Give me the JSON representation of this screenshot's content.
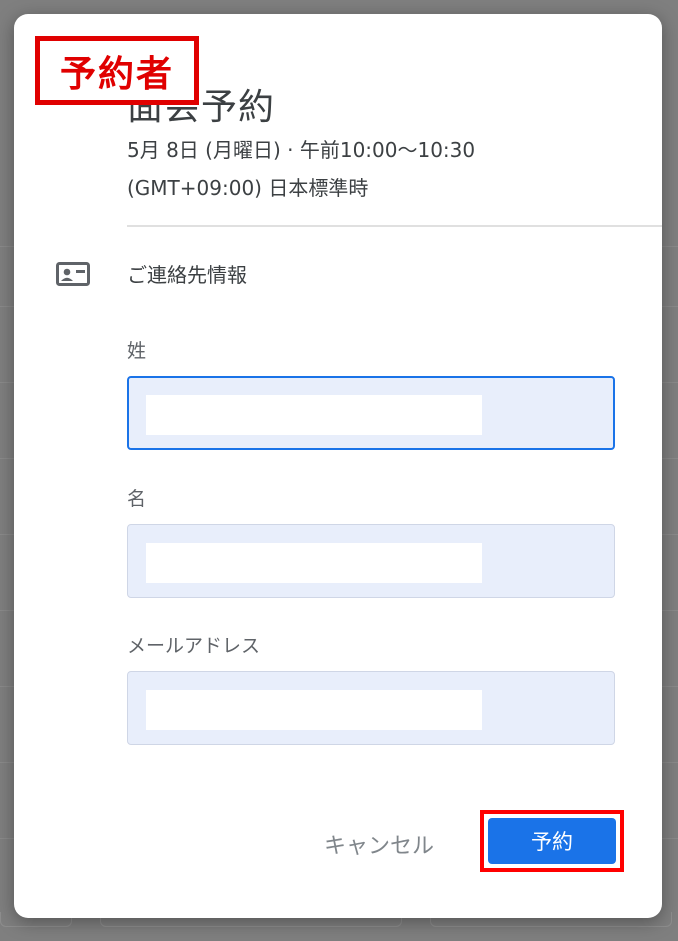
{
  "dialog": {
    "title": "面会予約",
    "datetime": "5月 8日 (月曜日) · 午前10:00～10:30",
    "timezone": "(GMT+09:00) 日本標準時",
    "section_title": "ご連絡先情報",
    "section_icon": "contact-card-icon"
  },
  "form": {
    "last_name_label": "姓",
    "last_name_value": "",
    "first_name_label": "名",
    "first_name_value": "",
    "email_label": "メールアドレス",
    "email_value": ""
  },
  "actions": {
    "cancel_label": "キャンセル",
    "reserve_label": "予約"
  },
  "annotation": {
    "label": "予約者",
    "color": "#e00000"
  },
  "colors": {
    "accent": "#1a73e8",
    "field_background": "#e8eefb",
    "highlight": "#ff0000"
  }
}
